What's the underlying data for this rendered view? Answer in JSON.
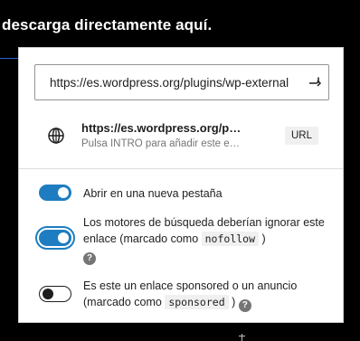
{
  "background": {
    "heading": "descarga directamente aquí."
  },
  "link_control": {
    "url_input": {
      "value": "https://es.wordpress.org/plugins/wp-external"
    },
    "submit_icon": "enter-return-icon",
    "suggestion": {
      "icon": "globe-icon",
      "title": "https://es.wordpress.org/p…",
      "info": "Pulsa INTRO para añadir este e…",
      "type": "URL"
    },
    "settings": [
      {
        "label": "Abrir en una nueva pestaña",
        "checked": true
      },
      {
        "label_before": "Los motores de búsqueda deberían ignorar este enlace (marcado como ",
        "code": "nofollow",
        "label_after": " )",
        "checked": true,
        "focused": true
      },
      {
        "label_before": "Es este un enlace sponsored o un anuncio (marcado como ",
        "code": "sponsored",
        "label_after": " )",
        "checked": false
      }
    ],
    "help_icon_glyph": "?"
  },
  "colors": {
    "accent": "#1e7dc0",
    "background": "#000000",
    "popover": "#ffffff"
  }
}
